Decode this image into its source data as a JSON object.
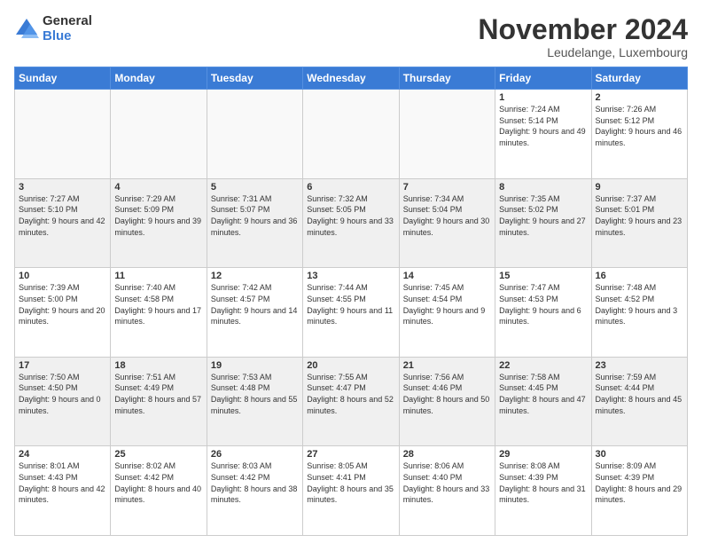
{
  "logo": {
    "general": "General",
    "blue": "Blue"
  },
  "header": {
    "month": "November 2024",
    "location": "Leudelange, Luxembourg"
  },
  "weekdays": [
    "Sunday",
    "Monday",
    "Tuesday",
    "Wednesday",
    "Thursday",
    "Friday",
    "Saturday"
  ],
  "weeks": [
    [
      {
        "day": "",
        "info": "",
        "empty": true
      },
      {
        "day": "",
        "info": "",
        "empty": true
      },
      {
        "day": "",
        "info": "",
        "empty": true
      },
      {
        "day": "",
        "info": "",
        "empty": true
      },
      {
        "day": "",
        "info": "",
        "empty": true
      },
      {
        "day": "1",
        "info": "Sunrise: 7:24 AM\nSunset: 5:14 PM\nDaylight: 9 hours\nand 49 minutes."
      },
      {
        "day": "2",
        "info": "Sunrise: 7:26 AM\nSunset: 5:12 PM\nDaylight: 9 hours\nand 46 minutes."
      }
    ],
    [
      {
        "day": "3",
        "info": "Sunrise: 7:27 AM\nSunset: 5:10 PM\nDaylight: 9 hours\nand 42 minutes."
      },
      {
        "day": "4",
        "info": "Sunrise: 7:29 AM\nSunset: 5:09 PM\nDaylight: 9 hours\nand 39 minutes."
      },
      {
        "day": "5",
        "info": "Sunrise: 7:31 AM\nSunset: 5:07 PM\nDaylight: 9 hours\nand 36 minutes."
      },
      {
        "day": "6",
        "info": "Sunrise: 7:32 AM\nSunset: 5:05 PM\nDaylight: 9 hours\nand 33 minutes."
      },
      {
        "day": "7",
        "info": "Sunrise: 7:34 AM\nSunset: 5:04 PM\nDaylight: 9 hours\nand 30 minutes."
      },
      {
        "day": "8",
        "info": "Sunrise: 7:35 AM\nSunset: 5:02 PM\nDaylight: 9 hours\nand 27 minutes."
      },
      {
        "day": "9",
        "info": "Sunrise: 7:37 AM\nSunset: 5:01 PM\nDaylight: 9 hours\nand 23 minutes."
      }
    ],
    [
      {
        "day": "10",
        "info": "Sunrise: 7:39 AM\nSunset: 5:00 PM\nDaylight: 9 hours\nand 20 minutes."
      },
      {
        "day": "11",
        "info": "Sunrise: 7:40 AM\nSunset: 4:58 PM\nDaylight: 9 hours\nand 17 minutes."
      },
      {
        "day": "12",
        "info": "Sunrise: 7:42 AM\nSunset: 4:57 PM\nDaylight: 9 hours\nand 14 minutes."
      },
      {
        "day": "13",
        "info": "Sunrise: 7:44 AM\nSunset: 4:55 PM\nDaylight: 9 hours\nand 11 minutes."
      },
      {
        "day": "14",
        "info": "Sunrise: 7:45 AM\nSunset: 4:54 PM\nDaylight: 9 hours\nand 9 minutes."
      },
      {
        "day": "15",
        "info": "Sunrise: 7:47 AM\nSunset: 4:53 PM\nDaylight: 9 hours\nand 6 minutes."
      },
      {
        "day": "16",
        "info": "Sunrise: 7:48 AM\nSunset: 4:52 PM\nDaylight: 9 hours\nand 3 minutes."
      }
    ],
    [
      {
        "day": "17",
        "info": "Sunrise: 7:50 AM\nSunset: 4:50 PM\nDaylight: 9 hours\nand 0 minutes."
      },
      {
        "day": "18",
        "info": "Sunrise: 7:51 AM\nSunset: 4:49 PM\nDaylight: 8 hours\nand 57 minutes."
      },
      {
        "day": "19",
        "info": "Sunrise: 7:53 AM\nSunset: 4:48 PM\nDaylight: 8 hours\nand 55 minutes."
      },
      {
        "day": "20",
        "info": "Sunrise: 7:55 AM\nSunset: 4:47 PM\nDaylight: 8 hours\nand 52 minutes."
      },
      {
        "day": "21",
        "info": "Sunrise: 7:56 AM\nSunset: 4:46 PM\nDaylight: 8 hours\nand 50 minutes."
      },
      {
        "day": "22",
        "info": "Sunrise: 7:58 AM\nSunset: 4:45 PM\nDaylight: 8 hours\nand 47 minutes."
      },
      {
        "day": "23",
        "info": "Sunrise: 7:59 AM\nSunset: 4:44 PM\nDaylight: 8 hours\nand 45 minutes."
      }
    ],
    [
      {
        "day": "24",
        "info": "Sunrise: 8:01 AM\nSunset: 4:43 PM\nDaylight: 8 hours\nand 42 minutes."
      },
      {
        "day": "25",
        "info": "Sunrise: 8:02 AM\nSunset: 4:42 PM\nDaylight: 8 hours\nand 40 minutes."
      },
      {
        "day": "26",
        "info": "Sunrise: 8:03 AM\nSunset: 4:42 PM\nDaylight: 8 hours\nand 38 minutes."
      },
      {
        "day": "27",
        "info": "Sunrise: 8:05 AM\nSunset: 4:41 PM\nDaylight: 8 hours\nand 35 minutes."
      },
      {
        "day": "28",
        "info": "Sunrise: 8:06 AM\nSunset: 4:40 PM\nDaylight: 8 hours\nand 33 minutes."
      },
      {
        "day": "29",
        "info": "Sunrise: 8:08 AM\nSunset: 4:39 PM\nDaylight: 8 hours\nand 31 minutes."
      },
      {
        "day": "30",
        "info": "Sunrise: 8:09 AM\nSunset: 4:39 PM\nDaylight: 8 hours\nand 29 minutes."
      }
    ]
  ]
}
